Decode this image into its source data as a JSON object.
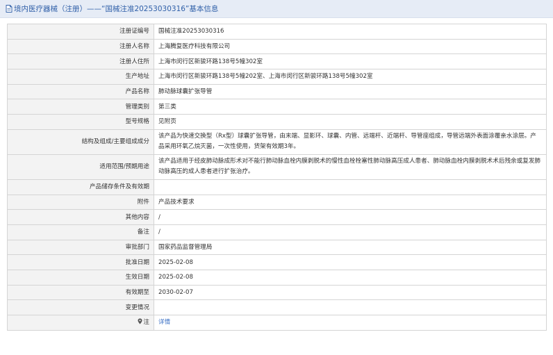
{
  "header": {
    "title": "境内医疗器械（注册）——“国械注准20253030316”基本信息"
  },
  "rows": [
    {
      "label": "注册证编号",
      "value": "国械注准20253030316"
    },
    {
      "label": "注册人名称",
      "value": "上海腾复医疗科技有限公司"
    },
    {
      "label": "注册人住所",
      "value": "上海市闵行区新骏环路138号5幢302室"
    },
    {
      "label": "生产地址",
      "value": "上海市闵行区新骏环路138号5幢202室、上海市闵行区新骏环路138号5幢302室"
    },
    {
      "label": "产品名称",
      "value": "肺动脉球囊扩张导管"
    },
    {
      "label": "管理类别",
      "value": "第三类"
    },
    {
      "label": "型号规格",
      "value": "见附页"
    },
    {
      "label": "结构及组成/主要组成成分",
      "value": "该产品为快速交换型（Rx型）球囊扩张导管，由末端、显影环、球囊、内管、远端杆、近端杆、导管座组成，导管远端外表面涂覆亲水涂层。产品采用环氧乙烷灭菌，一次性使用，货架有效期3年。"
    },
    {
      "label": "适用范围/预期用途",
      "value": "该产品适用于经皮肺动脉成形术对不能行肺动脉血栓内膜剥脱术的慢性血栓栓塞性肺动脉高压成人患者、肺动脉血栓内膜剥脱术术后残余或复发肺动脉高压的成人患者进行扩张治疗。"
    },
    {
      "label": "产品储存条件及有效期",
      "value": ""
    },
    {
      "label": "附件",
      "value": "产品技术要求"
    },
    {
      "label": "其他内容",
      "value": "/"
    },
    {
      "label": "备注",
      "value": "/"
    },
    {
      "label": "审批部门",
      "value": "国家药品监督管理局"
    },
    {
      "label": "批准日期",
      "value": "2025-02-08"
    },
    {
      "label": "生效日期",
      "value": "2025-02-08"
    },
    {
      "label": "有效期至",
      "value": "2030-02-07"
    },
    {
      "label": "变更情况",
      "value": ""
    },
    {
      "label": "注",
      "value": "详情",
      "pin_icon": "location-pin-icon"
    }
  ]
}
